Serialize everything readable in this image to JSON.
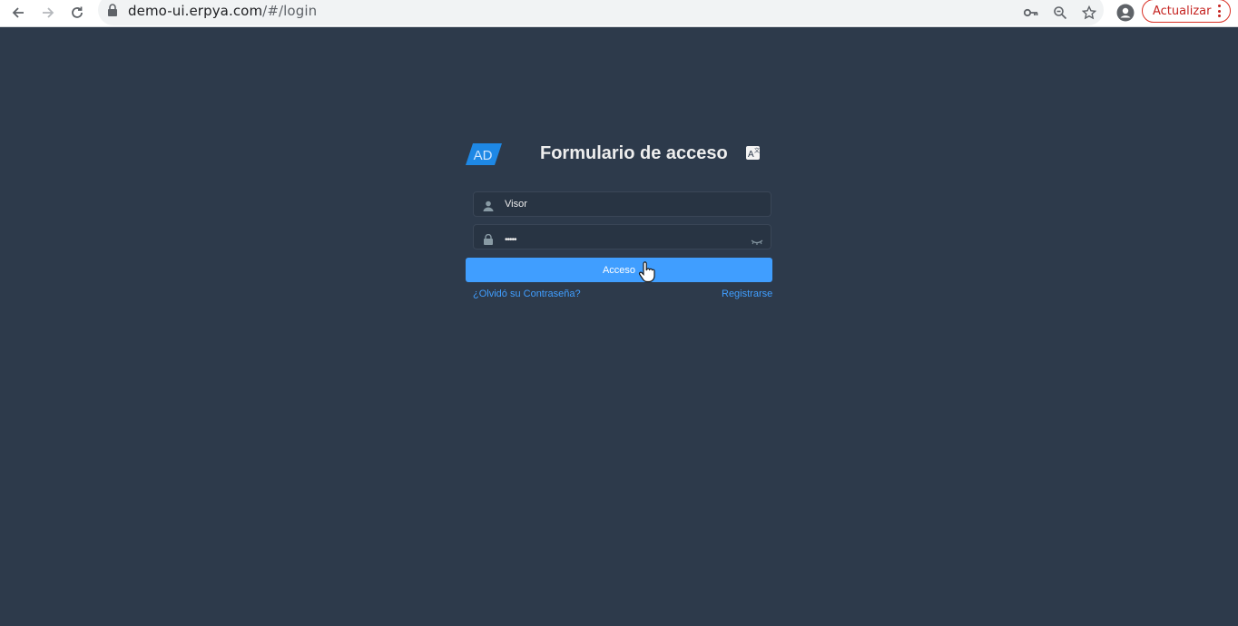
{
  "browser": {
    "url_host": "demo-ui.erpya.com",
    "url_path": "/#/login",
    "update_label": "Actualizar"
  },
  "login": {
    "logo_text": "AD",
    "title": "Formulario de acceso",
    "username_value": "Visor",
    "password_value": "•••••",
    "submit_label": "Acceso",
    "forgot_label": "¿Olvidó su Contraseña?",
    "register_label": "Registrarse"
  },
  "colors": {
    "background": "#2d3a4b",
    "input_bg": "#283443",
    "primary": "#409eff",
    "logo_blue": "#1e88e5"
  }
}
